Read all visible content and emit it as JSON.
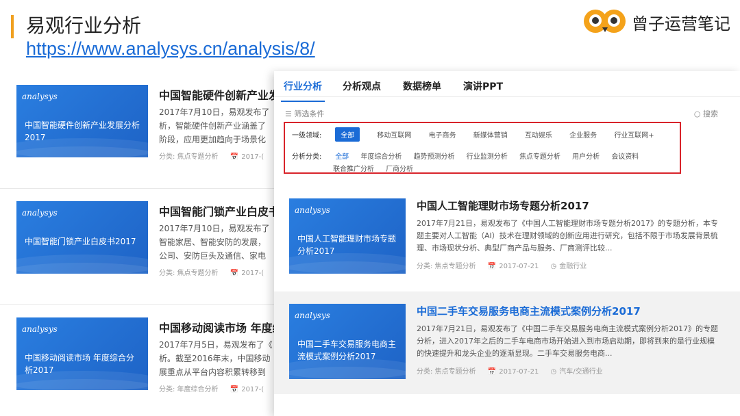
{
  "slide": {
    "title": "易观行业分析",
    "link": "https://www.analysys.cn/analysis/8/",
    "brand": "曾子运营笔记"
  },
  "left_list": [
    {
      "logo": "analysys",
      "thumb_title": "中国智能硬件创新产业发展分析2017",
      "title": "中国智能硬件创新产业发",
      "desc": [
        "2017年7月10日，易观发布了",
        "析，智能硬件创新产业涵盖了",
        "阶段，应用更加趋向于场景化"
      ],
      "category": "分类: 焦点专题分析",
      "date": "2017-("
    },
    {
      "logo": "analysys",
      "thumb_title": "中国智能门锁产业白皮书2017",
      "title": "中国智能门锁产业白皮书",
      "desc": [
        "2017年7月10日，易观发布了",
        "智能家居、智能安防的发展，",
        "公司、安防巨头及通信、家电"
      ],
      "category": "分类: 焦点专题分析",
      "date": "2017-("
    },
    {
      "logo": "analysys",
      "thumb_title": "中国移动阅读市场 年度综合分析2017",
      "title": "中国移动阅读市场 年度综",
      "desc": [
        "2017年7月5日，易观发布了《",
        "析。截至2016年末，中国移动",
        "展重点从平台内容积累转移到"
      ],
      "category": "分类: 年度综合分析",
      "date": "2017-("
    }
  ],
  "panel": {
    "tabs": [
      "行业分析",
      "分析观点",
      "数据榜单",
      "演讲PPT"
    ],
    "filter_label": "筛选条件",
    "search_label": "搜索",
    "domain_label": "一级领域:",
    "domains": [
      "全部",
      "移动互联网",
      "电子商务",
      "新媒体营销",
      "互动娱乐",
      "企业服务",
      "行业互联网+"
    ],
    "type_label": "分析分类:",
    "types_row1": [
      "全部",
      "年度综合分析",
      "趋势预测分析",
      "行业监测分析",
      "焦点专题分析",
      "用户分析",
      "会议资料"
    ],
    "types_row2": [
      "联合推广分析",
      "厂商分析"
    ],
    "cards": [
      {
        "logo": "analysys",
        "thumb_title": "中国人工智能理财市场专题分析2017",
        "title": "中国人工智能理财市场专题分析2017",
        "desc": "2017年7月21日，易观发布了《中国人工智能理财市场专题分析2017》的专题分析，本专题主要对人工智能（AI）技术在理财领域的创新应用进行研究，包括不限于市场发展背景梳理、市场现状分析、典型厂商产品与服务、厂商测评比较...",
        "category": "分类: 焦点专题分析",
        "date": "2017-07-21",
        "industry": "金融行业"
      },
      {
        "logo": "analysys",
        "thumb_title": "中国二手车交易服务电商主流模式案例分析2017",
        "title": "中国二手车交易服务电商主流模式案例分析2017",
        "desc": "2017年7月21日，易观发布了《中国二手车交易服务电商主流模式案例分析2017》的专题分析，进入2017年之后的二手车电商市场开始进入到市场启动期，即将到来的是行业规模的快速提升和龙头企业的逐渐显现。二手车交易服务电商...",
        "category": "分类: 焦点专题分析",
        "date": "2017-07-21",
        "industry": "汽车/交通行业"
      }
    ]
  }
}
